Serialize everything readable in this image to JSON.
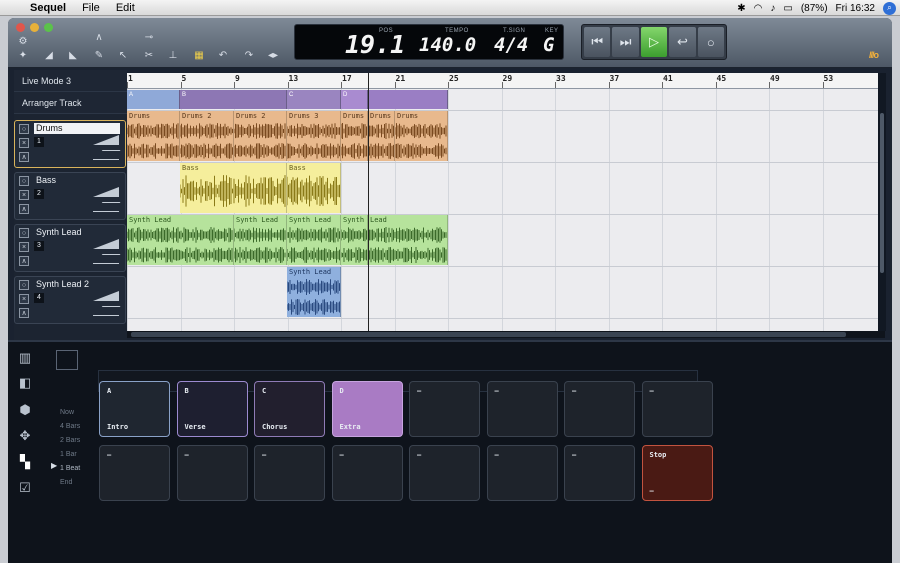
{
  "menubar": {
    "app_name": "Sequel",
    "menus": [
      "File",
      "Edit"
    ],
    "battery": "(87%)",
    "clock": "Fri 16:32"
  },
  "lcd": {
    "position": "19.1",
    "pos_label": "POS",
    "tempo": "140.0",
    "tempo_label": "TEMPO",
    "time_sig": "4/4",
    "time_sig_label": "T.SIGN",
    "key": "G",
    "key_label": "KEY"
  },
  "transport": [
    "⏮",
    "⏭",
    "▷",
    "↩",
    "○"
  ],
  "tracklist": {
    "live_mode": "Live Mode 3",
    "arranger_track": "Arranger Track",
    "tracks": [
      {
        "name": "Drums",
        "num": "1",
        "selected": true
      },
      {
        "name": "Bass",
        "num": "2",
        "selected": false
      },
      {
        "name": "Synth Lead",
        "num": "3",
        "selected": false
      },
      {
        "name": "Synth Lead 2",
        "num": "4",
        "selected": false
      }
    ]
  },
  "ruler": [
    "1",
    "5",
    "9",
    "13",
    "17",
    "21",
    "25",
    "29",
    "33",
    "37",
    "41",
    "45",
    "49",
    "53"
  ],
  "sections": [
    {
      "label": "A",
      "color": "#8fa9d8"
    },
    {
      "label": "B",
      "color": "#8d77b4"
    },
    {
      "label": "C",
      "color": "#9a85c0"
    },
    {
      "label": "D",
      "color": "#a98bd0"
    },
    {
      "label": "",
      "color": "#9a7ec4"
    }
  ],
  "clips": {
    "drums": [
      "Drums",
      "Drums 2",
      "Drums 2",
      "Drums 3",
      "Drums",
      "Drums"
    ],
    "bass": [
      "Bass",
      "Bass"
    ],
    "synth": [
      "Synth Lead",
      "Synth Lead",
      "Synth Lead",
      "Synth",
      "Lead"
    ],
    "synth2": [
      "Synth Lead"
    ]
  },
  "launch_quant": [
    "Now",
    "4 Bars",
    "2 Bars",
    "1 Bar",
    "1 Beat",
    "End"
  ],
  "pads_row1": [
    {
      "letter": "A",
      "name": "Intro"
    },
    {
      "letter": "B",
      "name": "Verse"
    },
    {
      "letter": "C",
      "name": "Chorus"
    },
    {
      "letter": "D",
      "name": "Extra"
    },
    {
      "letter": "–",
      "name": ""
    },
    {
      "letter": "–",
      "name": ""
    },
    {
      "letter": "–",
      "name": ""
    },
    {
      "letter": "–",
      "name": ""
    }
  ],
  "pads_row2": [
    {
      "letter": "–",
      "name": ""
    },
    {
      "letter": "–",
      "name": ""
    },
    {
      "letter": "–",
      "name": ""
    },
    {
      "letter": "–",
      "name": ""
    },
    {
      "letter": "–",
      "name": ""
    },
    {
      "letter": "–",
      "name": ""
    },
    {
      "letter": "–",
      "name": ""
    },
    {
      "letter": "Stop",
      "name": "–"
    }
  ],
  "colors": {
    "drums": "#e8b98d",
    "bass": "#f5ee9c",
    "synth": "#b6e39c",
    "synth2": "#8fb0de",
    "stop_pad": "#4a1a14",
    "extra_pad": "#a97bc4"
  }
}
